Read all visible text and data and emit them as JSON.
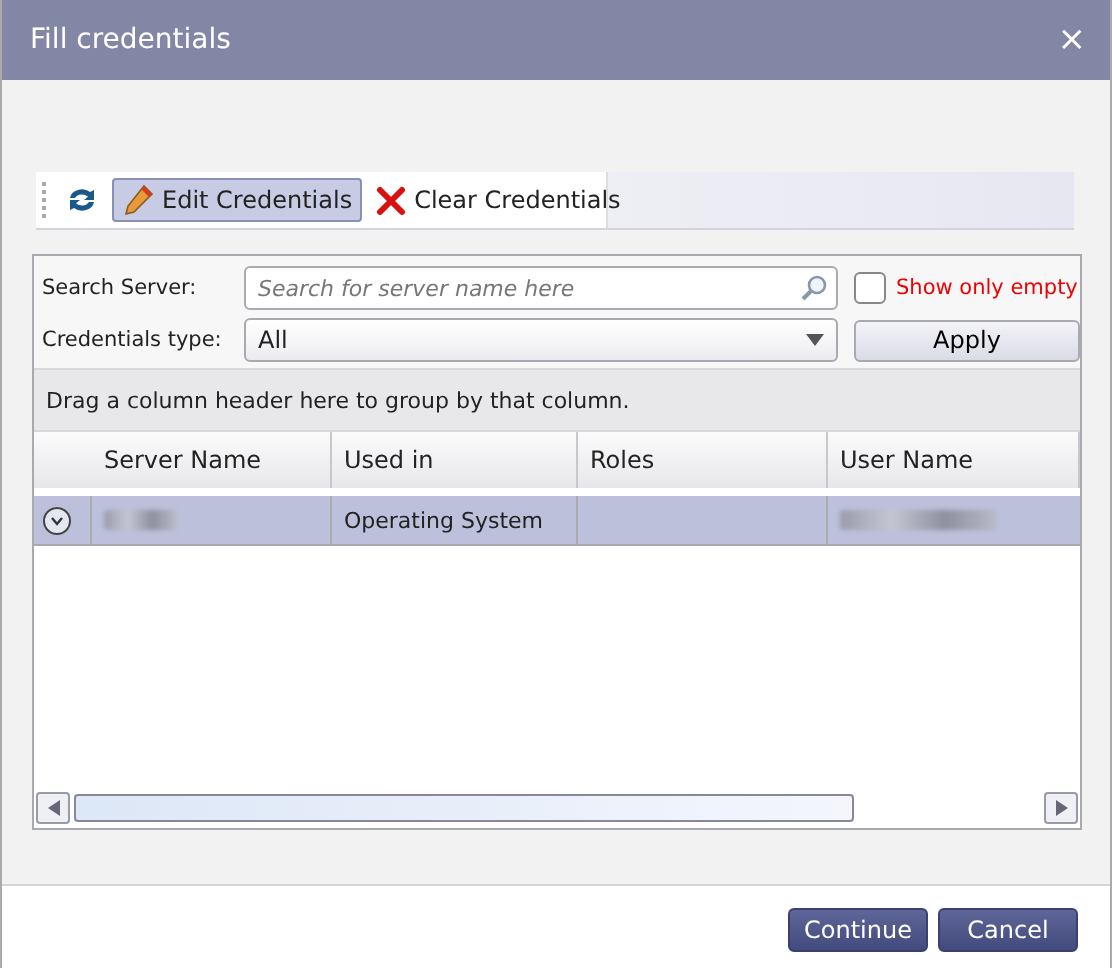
{
  "window": {
    "title": "Fill credentials",
    "close_icon": "×"
  },
  "toolbar": {
    "buttons": [
      {
        "kind": "refresh",
        "hovered": false
      },
      {
        "kind": "edit",
        "label": "Edit Credentials",
        "hovered": true
      },
      {
        "kind": "clear",
        "label": "Clear Credentials",
        "hovered": false
      }
    ]
  },
  "filters": {
    "search_label": "Search Server:",
    "search_placeholder": "Search for server name here",
    "show_only_empty": {
      "label": "Show only empty",
      "checked": false
    },
    "type_label": "Credentials type:",
    "type_value": "All",
    "apply": "Apply"
  },
  "grid": {
    "group_hint": "Drag a column header here to group by that column.",
    "columns": [
      "Server Name",
      "Used in",
      "Roles",
      "User Name"
    ],
    "rows": [
      {
        "selected": true,
        "expanded": false,
        "cells": [
          {
            "kind": "redacted"
          },
          {
            "kind": "text",
            "text": "Operating System"
          },
          {
            "kind": "empty"
          },
          {
            "kind": "redacted"
          }
        ]
      }
    ]
  },
  "buttons": [
    "Continue",
    "Cancel"
  ]
}
